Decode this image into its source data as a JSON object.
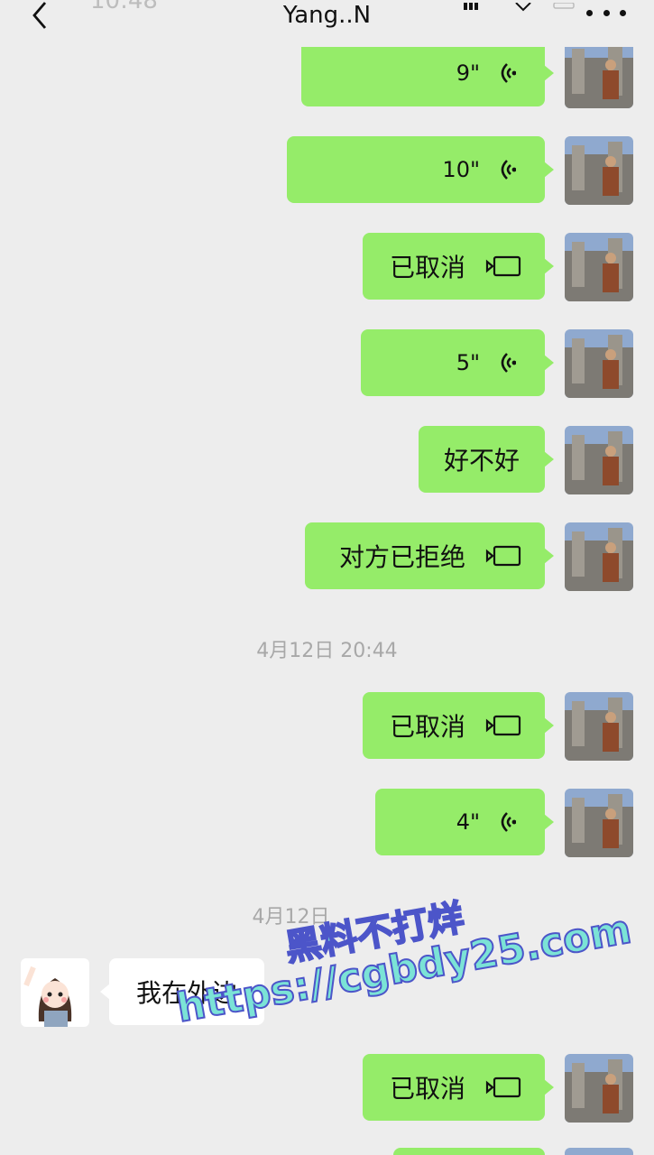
{
  "header": {
    "status_time": "10:48",
    "title": "Yang..N"
  },
  "messages": [
    {
      "kind": "voice",
      "side": "me",
      "text": "9\""
    },
    {
      "kind": "voice",
      "side": "me",
      "text": "10\""
    },
    {
      "kind": "call",
      "side": "me",
      "text": "已取消"
    },
    {
      "kind": "voice",
      "side": "me",
      "text": "5\""
    },
    {
      "kind": "text",
      "side": "me",
      "text": "好不好"
    },
    {
      "kind": "call",
      "side": "me",
      "text": "对方已拒绝"
    },
    {
      "kind": "timestamp",
      "text": "4月12日 20:44"
    },
    {
      "kind": "call",
      "side": "me",
      "text": "已取消"
    },
    {
      "kind": "voice",
      "side": "me",
      "text": "4\""
    },
    {
      "kind": "timestamp",
      "text": "4月12日"
    },
    {
      "kind": "text",
      "side": "other",
      "text": "我在外边"
    },
    {
      "kind": "call",
      "side": "me",
      "text": "已取消"
    }
  ],
  "watermark": {
    "line1": "黑料不打烊",
    "line2": "https://cgbdy25.com"
  },
  "colors": {
    "background": "#ededed",
    "my_bubble": "#95ec69",
    "other_bubble": "#ffffff",
    "timestamp_text": "#a8a8a8"
  }
}
